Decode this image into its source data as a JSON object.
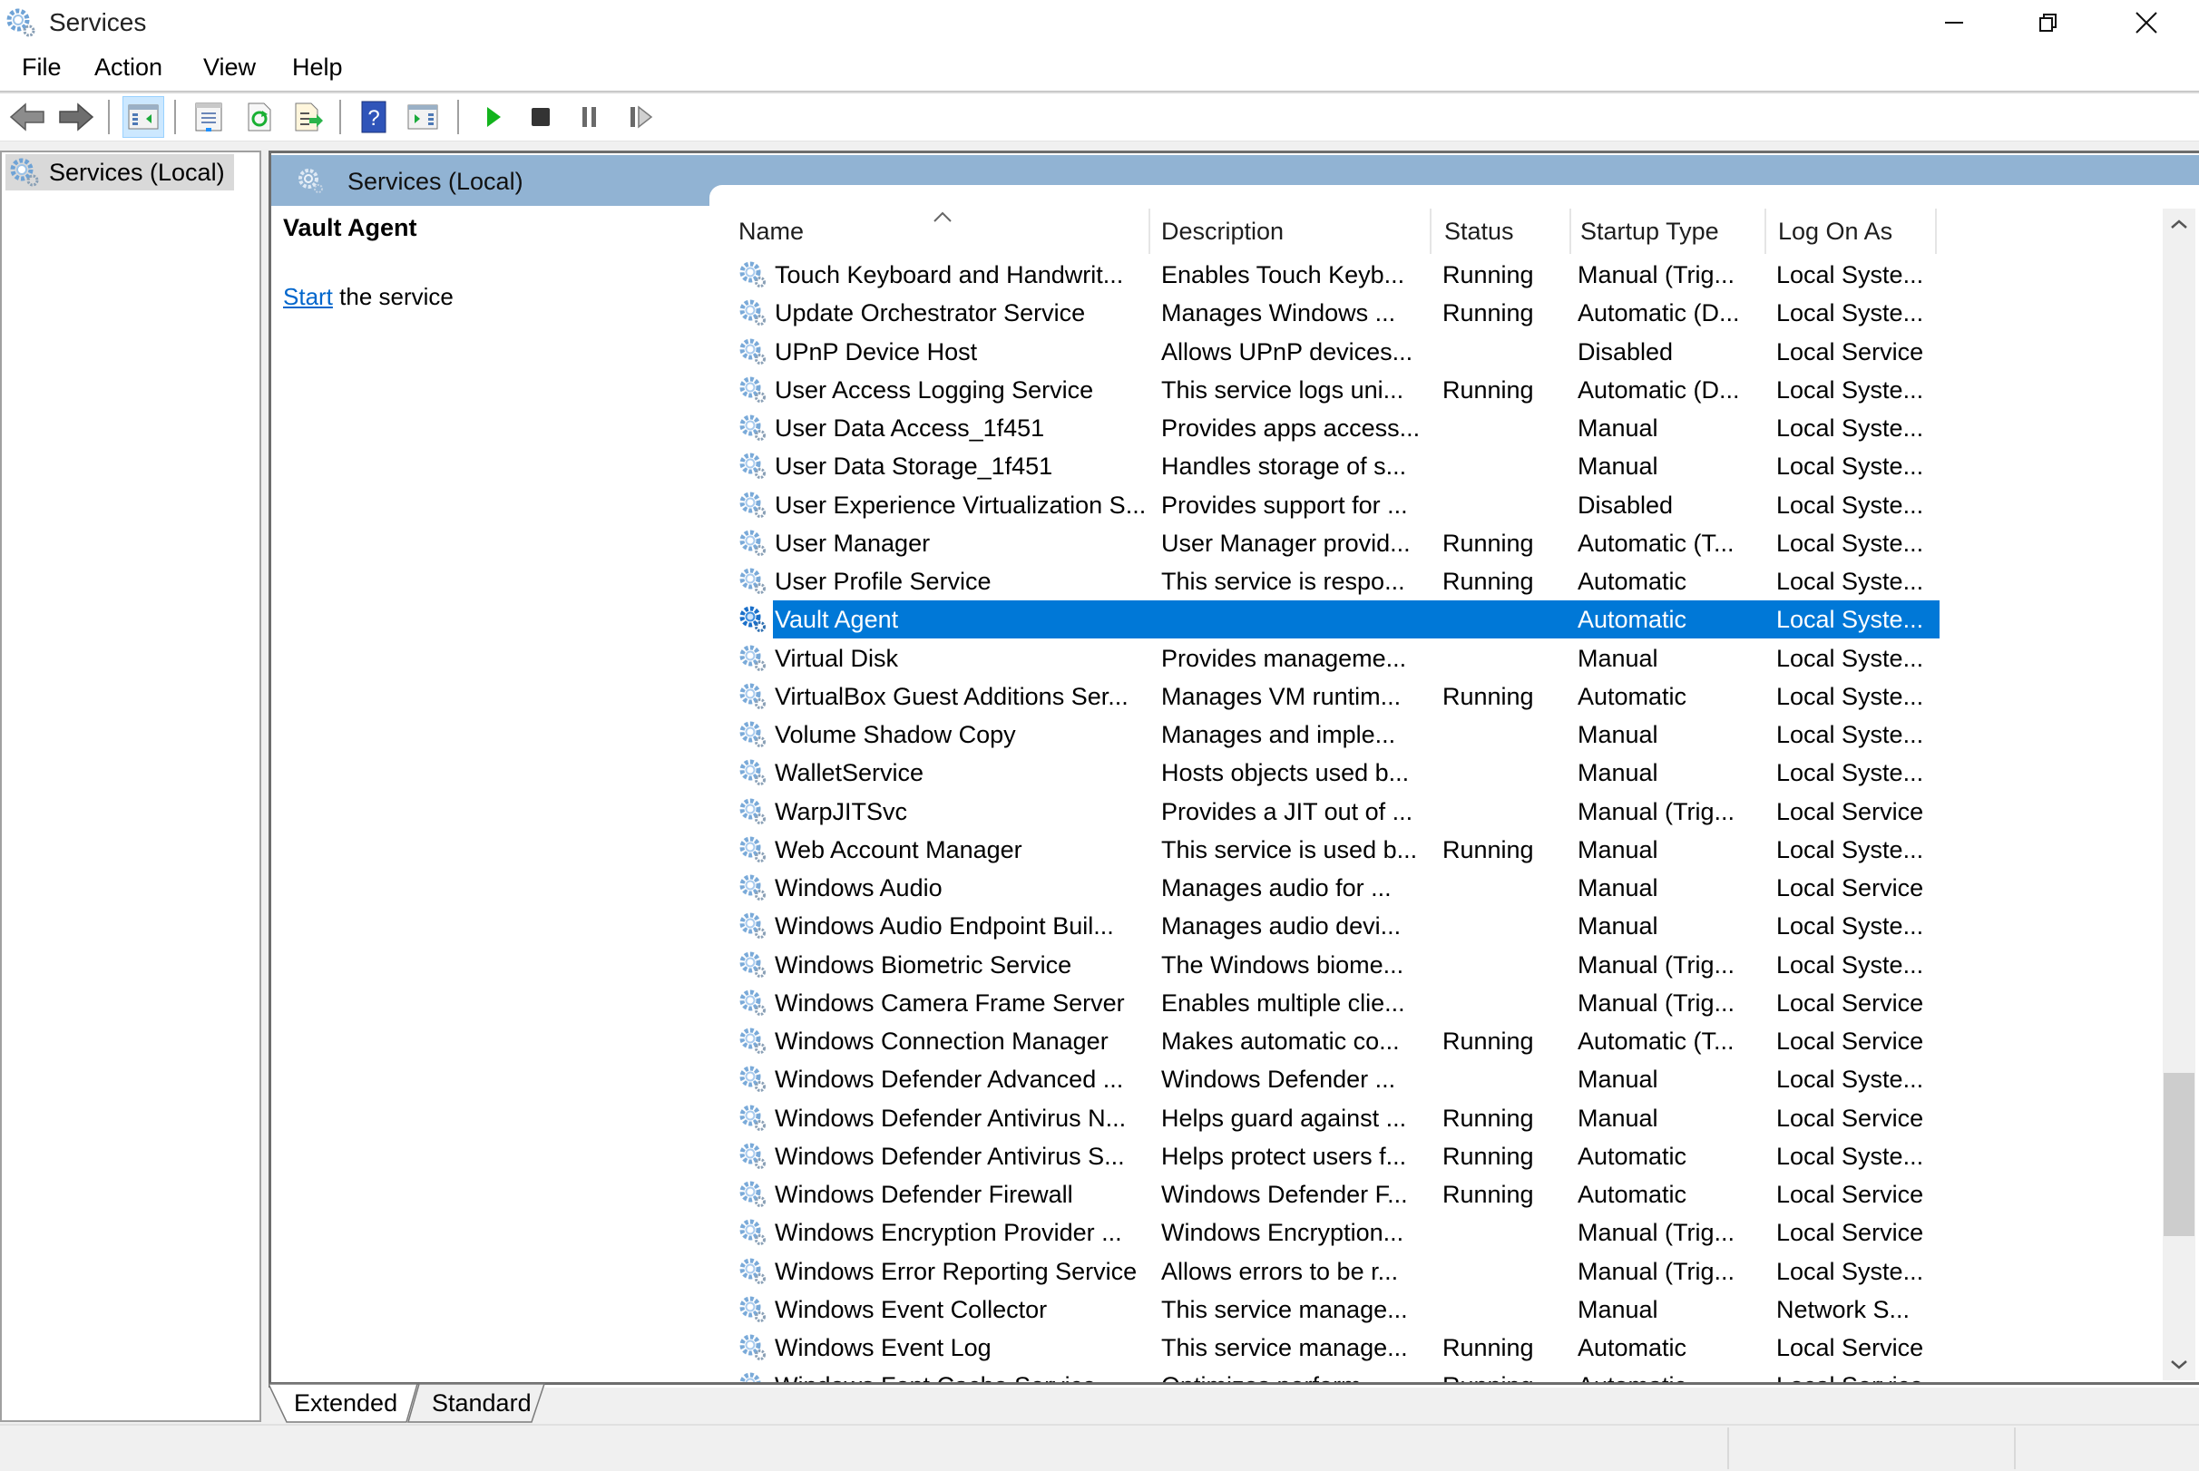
{
  "window": {
    "title": "Services",
    "icon": "services-gear-icon",
    "controls": {
      "minimize": "minimize-icon",
      "restore": "restore-icon",
      "close": "close-icon"
    }
  },
  "menu": [
    "File",
    "Action",
    "View",
    "Help"
  ],
  "toolbar": [
    {
      "name": "back-button",
      "icon": "arrow-left-icon"
    },
    {
      "name": "forward-button",
      "icon": "arrow-right-icon"
    },
    {
      "name": "show-hide-console-tree-button",
      "icon": "console-tree-icon",
      "active": true
    },
    {
      "name": "properties-button",
      "icon": "properties-icon"
    },
    {
      "name": "refresh-button",
      "icon": "refresh-icon"
    },
    {
      "name": "export-list-button",
      "icon": "export-list-icon"
    },
    {
      "name": "help-button",
      "icon": "help-icon"
    },
    {
      "name": "show-hide-action-pane-button",
      "icon": "action-pane-icon"
    },
    {
      "name": "start-service-button",
      "icon": "play-icon"
    },
    {
      "name": "stop-service-button",
      "icon": "stop-icon"
    },
    {
      "name": "pause-service-button",
      "icon": "pause-icon"
    },
    {
      "name": "restart-service-button",
      "icon": "restart-icon"
    }
  ],
  "tree": {
    "root_label": "Services (Local)"
  },
  "panel": {
    "title": "Services (Local)",
    "detail": {
      "service_name": "Vault Agent",
      "action_link": "Start",
      "action_suffix": " the service"
    }
  },
  "columns": {
    "name": "Name",
    "description": "Description",
    "status": "Status",
    "startup_type": "Startup Type",
    "log_on_as": "Log On As",
    "sorted_by": "Name",
    "sort_direction": "ascending"
  },
  "colors": {
    "selection": "#0078d7",
    "panel_header": "#91b3d3",
    "link": "#0066cc"
  },
  "selected_service": "Vault Agent",
  "services": [
    {
      "name": "Touch Keyboard and Handwrit...",
      "description": "Enables Touch Keyb...",
      "status": "Running",
      "startup_type": "Manual (Trig...",
      "log_on_as": "Local Syste..."
    },
    {
      "name": "Update Orchestrator Service",
      "description": "Manages Windows ...",
      "status": "Running",
      "startup_type": "Automatic (D...",
      "log_on_as": "Local Syste..."
    },
    {
      "name": "UPnP Device Host",
      "description": "Allows UPnP devices...",
      "status": "",
      "startup_type": "Disabled",
      "log_on_as": "Local Service"
    },
    {
      "name": "User Access Logging Service",
      "description": "This service logs uni...",
      "status": "Running",
      "startup_type": "Automatic (D...",
      "log_on_as": "Local Syste..."
    },
    {
      "name": "User Data Access_1f451",
      "description": "Provides apps access...",
      "status": "",
      "startup_type": "Manual",
      "log_on_as": "Local Syste..."
    },
    {
      "name": "User Data Storage_1f451",
      "description": "Handles storage of s...",
      "status": "",
      "startup_type": "Manual",
      "log_on_as": "Local Syste..."
    },
    {
      "name": "User Experience Virtualization S...",
      "description": "Provides support for ...",
      "status": "",
      "startup_type": "Disabled",
      "log_on_as": "Local Syste..."
    },
    {
      "name": "User Manager",
      "description": "User Manager provid...",
      "status": "Running",
      "startup_type": "Automatic (T...",
      "log_on_as": "Local Syste..."
    },
    {
      "name": "User Profile Service",
      "description": "This service is respo...",
      "status": "Running",
      "startup_type": "Automatic",
      "log_on_as": "Local Syste..."
    },
    {
      "name": "Vault Agent",
      "description": "",
      "status": "",
      "startup_type": "Automatic",
      "log_on_as": "Local Syste...",
      "selected": true
    },
    {
      "name": "Virtual Disk",
      "description": "Provides manageme...",
      "status": "",
      "startup_type": "Manual",
      "log_on_as": "Local Syste..."
    },
    {
      "name": "VirtualBox Guest Additions Ser...",
      "description": "Manages VM runtim...",
      "status": "Running",
      "startup_type": "Automatic",
      "log_on_as": "Local Syste..."
    },
    {
      "name": "Volume Shadow Copy",
      "description": "Manages and imple...",
      "status": "",
      "startup_type": "Manual",
      "log_on_as": "Local Syste..."
    },
    {
      "name": "WalletService",
      "description": "Hosts objects used b...",
      "status": "",
      "startup_type": "Manual",
      "log_on_as": "Local Syste..."
    },
    {
      "name": "WarpJITSvc",
      "description": "Provides a JIT out of ...",
      "status": "",
      "startup_type": "Manual (Trig...",
      "log_on_as": "Local Service"
    },
    {
      "name": "Web Account Manager",
      "description": "This service is used b...",
      "status": "Running",
      "startup_type": "Manual",
      "log_on_as": "Local Syste..."
    },
    {
      "name": "Windows Audio",
      "description": "Manages audio for ...",
      "status": "",
      "startup_type": "Manual",
      "log_on_as": "Local Service"
    },
    {
      "name": "Windows Audio Endpoint Buil...",
      "description": "Manages audio devi...",
      "status": "",
      "startup_type": "Manual",
      "log_on_as": "Local Syste..."
    },
    {
      "name": "Windows Biometric Service",
      "description": "The Windows biome...",
      "status": "",
      "startup_type": "Manual (Trig...",
      "log_on_as": "Local Syste..."
    },
    {
      "name": "Windows Camera Frame Server",
      "description": "Enables multiple clie...",
      "status": "",
      "startup_type": "Manual (Trig...",
      "log_on_as": "Local Service"
    },
    {
      "name": "Windows Connection Manager",
      "description": "Makes automatic co...",
      "status": "Running",
      "startup_type": "Automatic (T...",
      "log_on_as": "Local Service"
    },
    {
      "name": "Windows Defender Advanced ...",
      "description": "Windows Defender ...",
      "status": "",
      "startup_type": "Manual",
      "log_on_as": "Local Syste..."
    },
    {
      "name": "Windows Defender Antivirus N...",
      "description": "Helps guard against ...",
      "status": "Running",
      "startup_type": "Manual",
      "log_on_as": "Local Service"
    },
    {
      "name": "Windows Defender Antivirus S...",
      "description": "Helps protect users f...",
      "status": "Running",
      "startup_type": "Automatic",
      "log_on_as": "Local Syste..."
    },
    {
      "name": "Windows Defender Firewall",
      "description": "Windows Defender F...",
      "status": "Running",
      "startup_type": "Automatic",
      "log_on_as": "Local Service"
    },
    {
      "name": "Windows Encryption Provider ...",
      "description": "Windows Encryption...",
      "status": "",
      "startup_type": "Manual (Trig...",
      "log_on_as": "Local Service"
    },
    {
      "name": "Windows Error Reporting Service",
      "description": "Allows errors to be r...",
      "status": "",
      "startup_type": "Manual (Trig...",
      "log_on_as": "Local Syste..."
    },
    {
      "name": "Windows Event Collector",
      "description": "This service manage...",
      "status": "",
      "startup_type": "Manual",
      "log_on_as": "Network S..."
    },
    {
      "name": "Windows Event Log",
      "description": "This service manage...",
      "status": "Running",
      "startup_type": "Automatic",
      "log_on_as": "Local Service"
    },
    {
      "name": "Windows Font Cache Service",
      "description": "Optimizes perform...",
      "status": "Running",
      "startup_type": "Automatic",
      "log_on_as": "Local Service",
      "partially_visible": true
    }
  ],
  "view_tabs": [
    {
      "label": "Extended",
      "active": true
    },
    {
      "label": "Standard",
      "active": false
    }
  ],
  "scrollbar": {
    "position_fraction": 0.88
  }
}
